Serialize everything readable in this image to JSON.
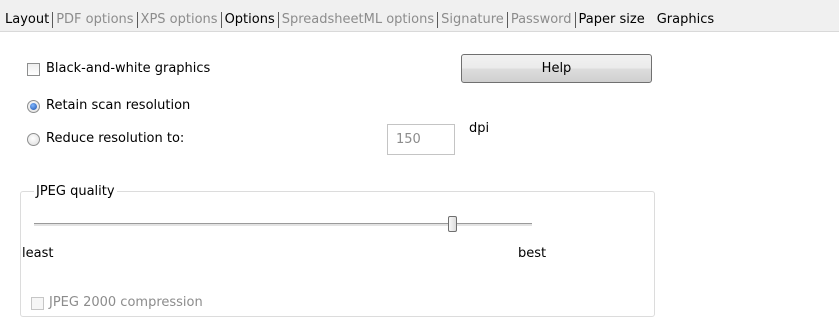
{
  "tabs": [
    {
      "label": "Layout",
      "state": "enabled"
    },
    {
      "label": "PDF options",
      "state": "disabled"
    },
    {
      "label": "XPS options",
      "state": "disabled"
    },
    {
      "label": "Options",
      "state": "enabled"
    },
    {
      "label": "SpreadsheetML options",
      "state": "disabled"
    },
    {
      "label": "Signature",
      "state": "disabled"
    },
    {
      "label": "Password",
      "state": "disabled"
    },
    {
      "label": "Paper size",
      "state": "enabled"
    },
    {
      "label": "Graphics",
      "state": "selected"
    }
  ],
  "graphics": {
    "black_white_label": "Black-and-white graphics",
    "black_white_checked": false,
    "help_label": "Help",
    "retain_label": "Retain scan resolution",
    "reduce_label": "Reduce resolution to:",
    "selected_resolution_option": "retain",
    "resolution_value": "150",
    "resolution_unit": "dpi",
    "jpeg_group_title": "JPEG quality",
    "jpeg_quality_level": 0.84,
    "slider_min_label": "least",
    "slider_max_label": "best",
    "jpeg2000_label": "JPEG 2000 compression",
    "jpeg2000_checked": false,
    "jpeg2000_enabled": false
  },
  "colors": {
    "disabled_text": "#8c8c8c",
    "radio_selected": "#1b4fa8"
  }
}
